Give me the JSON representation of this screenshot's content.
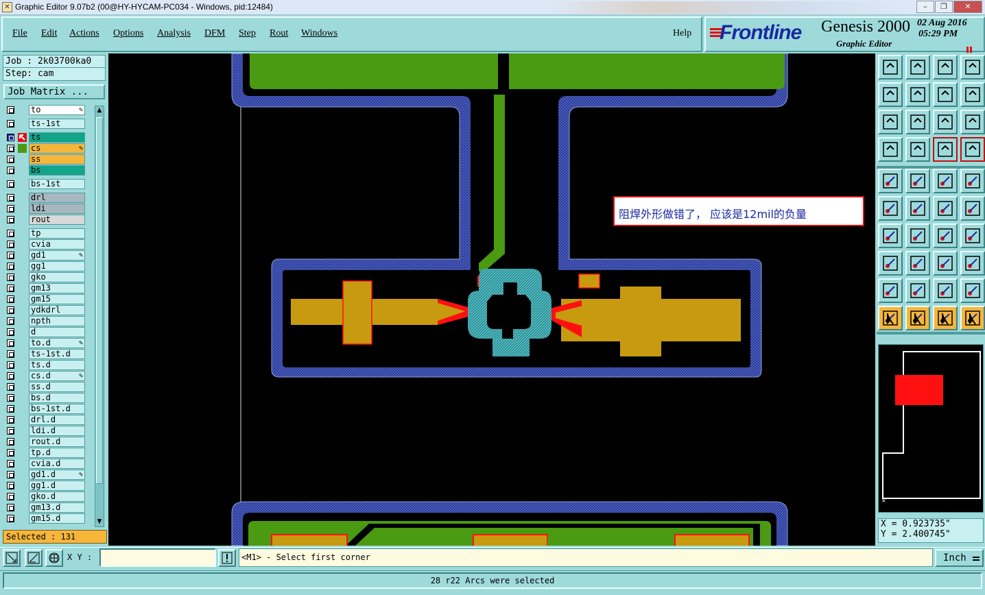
{
  "window": {
    "title": "Graphic Editor 9.07b2 (00@HY-HYCAM-PC034 - Windows, pid:12484)",
    "minimize": "–",
    "maximize": "❐",
    "close": "✕"
  },
  "menu": {
    "file": "File",
    "edit": "Edit",
    "actions": "Actions",
    "options": "Options",
    "analysis": "Analysis",
    "dfm": "DFM",
    "step": "Step",
    "rout": "Rout",
    "windows": "Windows",
    "help": "Help"
  },
  "brand": {
    "logo": "Frontline",
    "product": "Genesis 2000",
    "subtitle": "Graphic Editor",
    "date": "02 Aug 2016",
    "time": "05:29 PM"
  },
  "job": {
    "job_line": "Job : 2k03700ka0",
    "step_line": "Step: cam",
    "matrix_button": "Job Matrix ..."
  },
  "layers": [
    {
      "name": "to",
      "color": "#ffffff",
      "edit": true
    },
    {
      "name": "ts-1st",
      "color": "#c8f0f0"
    },
    {
      "name": "ts",
      "color": "#12a58a",
      "active": true
    },
    {
      "name": "cs",
      "color": "#f5b63a",
      "edit": true
    },
    {
      "name": "ss",
      "color": "#f5b63a"
    },
    {
      "name": "bs",
      "color": "#12a58a"
    },
    {
      "name": "bs-1st",
      "color": "#c8f0f0"
    },
    {
      "name": "drl",
      "color": "#a9b8c0"
    },
    {
      "name": "ldi",
      "color": "#a9b8c0"
    },
    {
      "name": "rout",
      "color": "#d8d8d8"
    },
    {
      "name": "tp",
      "color": "#c8f0f0"
    },
    {
      "name": "cvia",
      "color": "#c8f0f0"
    },
    {
      "name": "gd1",
      "color": "#c8f0f0",
      "edit": true
    },
    {
      "name": "gg1",
      "color": "#c8f0f0"
    },
    {
      "name": "gko",
      "color": "#c8f0f0"
    },
    {
      "name": "gm13",
      "color": "#c8f0f0"
    },
    {
      "name": "gm15",
      "color": "#c8f0f0"
    },
    {
      "name": "ydkdrl",
      "color": "#c8f0f0"
    },
    {
      "name": "npth",
      "color": "#c8f0f0"
    },
    {
      "name": "d",
      "color": "#c8f0f0"
    },
    {
      "name": "to.d",
      "color": "#c8f0f0",
      "edit": true
    },
    {
      "name": "ts-1st.d",
      "color": "#c8f0f0"
    },
    {
      "name": "ts.d",
      "color": "#c8f0f0"
    },
    {
      "name": "cs.d",
      "color": "#c8f0f0",
      "edit": true
    },
    {
      "name": "ss.d",
      "color": "#c8f0f0"
    },
    {
      "name": "bs.d",
      "color": "#c8f0f0"
    },
    {
      "name": "bs-1st.d",
      "color": "#c8f0f0"
    },
    {
      "name": "drl.d",
      "color": "#c8f0f0"
    },
    {
      "name": "ldi.d",
      "color": "#c8f0f0"
    },
    {
      "name": "rout.d",
      "color": "#c8f0f0"
    },
    {
      "name": "tp.d",
      "color": "#c8f0f0"
    },
    {
      "name": "cvia.d",
      "color": "#c8f0f0"
    },
    {
      "name": "gd1.d",
      "color": "#c8f0f0",
      "edit": true
    },
    {
      "name": "gg1.d",
      "color": "#c8f0f0"
    },
    {
      "name": "gko.d",
      "color": "#c8f0f0"
    },
    {
      "name": "gm13.d",
      "color": "#c8f0f0"
    },
    {
      "name": "gm15.d",
      "color": "#c8f0f0"
    }
  ],
  "selected_text": "Selected : 131",
  "annotation": "阻焊外形做错了， 应该是12mil的负量",
  "coords": {
    "x": "X = 0.923735\"",
    "y": "Y = 2.400745\""
  },
  "bottom": {
    "xy_label": "X Y :",
    "xy_value": "",
    "prompt": "<M1> - Select first corner",
    "units": "Inch",
    "status": "28 r22 Arcs were selected"
  },
  "colors": {
    "panel": "#9fdadb",
    "copper_green": "#4a9a12",
    "mask_navy": "#2d3a9a",
    "pad_gold": "#c89a10",
    "highlight_red": "#ff1010",
    "teal_ring": "#3aa8a8"
  }
}
